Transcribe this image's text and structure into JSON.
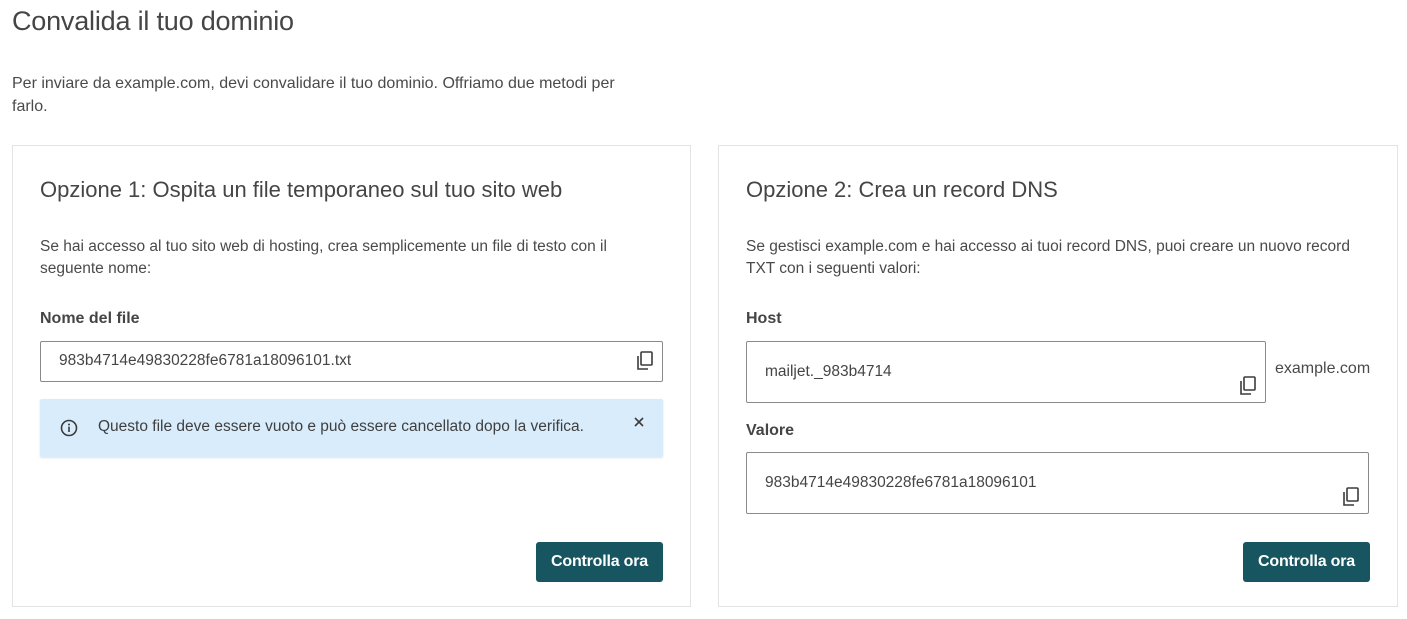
{
  "page": {
    "title": "Convalida il tuo dominio",
    "intro": "Per inviare da example.com, devi convalidare il tuo dominio. Offriamo due metodi per farlo."
  },
  "option1": {
    "title": "Opzione 1: Ospita un file temporaneo sul tuo sito web",
    "description": "Se hai accesso al tuo sito web di hosting, crea semplicemente un file di testo con il seguente nome:",
    "file_label": "Nome del file",
    "file_value": "983b4714e49830228fe6781a18096101.txt",
    "alert_text": "Questo file deve essere vuoto e può essere cancellato dopo la verifica.",
    "button_label": "Controlla ora"
  },
  "option2": {
    "title": "Opzione 2: Crea un record DNS",
    "description": "Se gestisci example.com e hai accesso ai tuoi record DNS, puoi creare un nuovo record TXT con i seguenti valori:",
    "host_label": "Host",
    "host_value": "mailjet._983b4714",
    "host_suffix": "example.com",
    "value_label": "Valore",
    "value_value": "983b4714e49830228fe6781a18096101",
    "button_label": "Controlla ora"
  },
  "colors": {
    "button_bg": "#175560",
    "alert_bg": "#d9ecfb",
    "text": "#454545"
  },
  "icons": {
    "copy": "copy-icon",
    "info": "info-icon",
    "close": "close-icon"
  }
}
